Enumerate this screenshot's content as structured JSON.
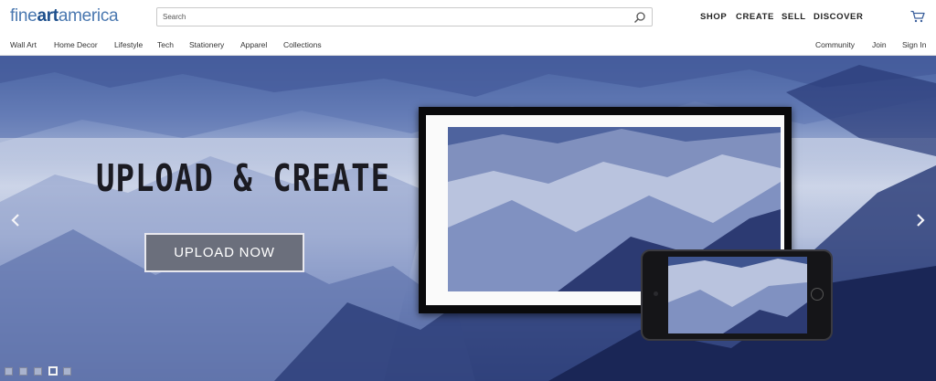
{
  "logo": {
    "part1": "fine",
    "part2": "art",
    "part3": "america"
  },
  "search": {
    "placeholder": "Search",
    "value": ""
  },
  "main_nav": [
    {
      "label": "SHOP"
    },
    {
      "label": "CREATE"
    },
    {
      "label": "SELL"
    },
    {
      "label": "DISCOVER"
    }
  ],
  "categories": [
    {
      "label": "Wall Art"
    },
    {
      "label": "Home Decor"
    },
    {
      "label": "Lifestyle"
    },
    {
      "label": "Tech"
    },
    {
      "label": "Stationery"
    },
    {
      "label": "Apparel"
    },
    {
      "label": "Collections"
    }
  ],
  "account_nav": [
    {
      "label": "Community"
    },
    {
      "label": "Join"
    },
    {
      "label": "Sign In"
    }
  ],
  "hero": {
    "headline": "UPLOAD & CREATE",
    "cta": "UPLOAD NOW",
    "slide_count": 5,
    "active_slide": 4
  },
  "icons": {
    "search": "magnifier-icon",
    "cart": "cart-icon",
    "prev": "chevron-left-icon",
    "next": "chevron-right-icon"
  },
  "colors": {
    "brand_blue": "#1d4f8c",
    "logo_light": "#4a78b0",
    "button": "#6b6f7c"
  }
}
